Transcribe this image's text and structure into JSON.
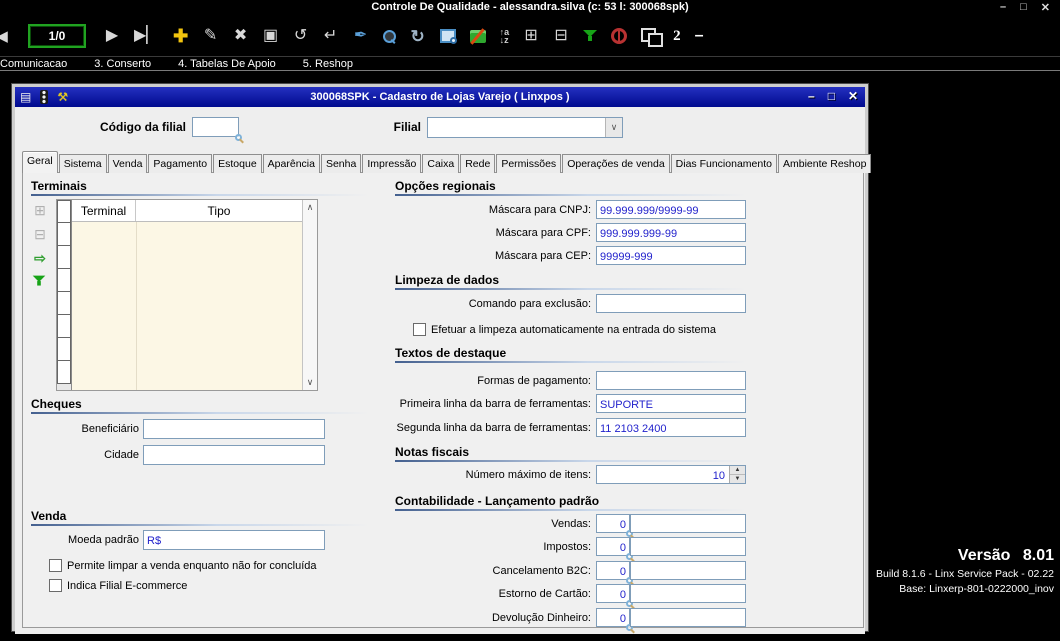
{
  "app": {
    "title": "Controle De Qualidade - alessandra.silva (c: 53 l: 300068spk)",
    "controls": {
      "minimize": "–",
      "maximize": "□",
      "close": "✕"
    }
  },
  "toolbar": {
    "record_counter": "1/0",
    "window_count": "2",
    "dash": "–",
    "icons": {
      "prev": "◀",
      "next": "▶",
      "last": "▶▏",
      "add": "✚",
      "edit": "✎",
      "delete": "✖",
      "save": "▣",
      "revert": "↺",
      "undo": "↵",
      "brush": "✒",
      "refresh": "↻",
      "sort_up": "↑a",
      "sort_down": "↓z",
      "add_detail": "⊞",
      "remove_detail": "⊟"
    }
  },
  "menubar": {
    "items": [
      {
        "label": "Comunicacao"
      },
      {
        "label": "3. Conserto"
      },
      {
        "label": "4. Tabelas De Apoio"
      },
      {
        "label": "5. Reshop"
      }
    ]
  },
  "dialog": {
    "title": "300068SPK - Cadastro de Lojas Varejo ( Linxpos )",
    "controls": {
      "minimize": "–",
      "maximize": "□",
      "close": "✕"
    },
    "header": {
      "codigo_label": "Código da filial",
      "codigo_value": "",
      "filial_label": "Filial",
      "filial_value": ""
    },
    "tabs": [
      {
        "label": "Geral"
      },
      {
        "label": "Sistema"
      },
      {
        "label": "Venda"
      },
      {
        "label": "Pagamento"
      },
      {
        "label": "Estoque"
      },
      {
        "label": "Aparência"
      },
      {
        "label": "Senha"
      },
      {
        "label": "Impressão"
      },
      {
        "label": "Caixa"
      },
      {
        "label": "Rede"
      },
      {
        "label": "Permissões"
      },
      {
        "label": "Operações de venda"
      },
      {
        "label": "Dias Funcionamento"
      },
      {
        "label": "Ambiente Reshop"
      }
    ],
    "terminais": {
      "title": "Terminais",
      "columns": {
        "terminal": "Terminal",
        "tipo": "Tipo"
      },
      "side_icons": {
        "insert": "⊞",
        "remove": "⊟",
        "export": "⇨"
      }
    },
    "cheques": {
      "title": "Cheques",
      "beneficiario_label": "Beneficiário",
      "beneficiario_value": "",
      "cidade_label": "Cidade",
      "cidade_value": ""
    },
    "venda": {
      "title": "Venda",
      "moeda_label": "Moeda padrão",
      "moeda_value": "R$",
      "checkbox_limpar": "Permite limpar a venda enquanto não for concluída",
      "checkbox_ecommerce": "Indica Filial E-commerce"
    },
    "opcoes_regionais": {
      "title": "Opções regionais",
      "rows": [
        {
          "label": "Máscara para CNPJ:",
          "value": "99.999.999/9999-99"
        },
        {
          "label": "Máscara para CPF:",
          "value": "999.999.999-99"
        },
        {
          "label": "Máscara para CEP:",
          "value": "99999-999"
        }
      ]
    },
    "limpeza": {
      "title": "Limpeza de dados",
      "comando_label": "Comando para exclusão:",
      "comando_value": "",
      "checkbox": "Efetuar a limpeza automaticamente na entrada do sistema"
    },
    "textos": {
      "title": "Textos de destaque",
      "rows": [
        {
          "label": "Formas de pagamento:",
          "value": ""
        },
        {
          "label": "Primeira linha da barra de ferramentas:",
          "value": "SUPORTE"
        },
        {
          "label": "Segunda linha da barra de ferramentas:",
          "value": "11 2103 2400"
        }
      ]
    },
    "notas": {
      "title": "Notas fiscais",
      "label": "Número máximo de itens:",
      "value": "10"
    },
    "contabilidade": {
      "title": "Contabilidade - Lançamento padrão",
      "rows": [
        {
          "label": "Vendas:",
          "value": "0"
        },
        {
          "label": "Impostos:",
          "value": "0"
        },
        {
          "label": "Cancelamento B2C:",
          "value": "0"
        },
        {
          "label": "Estorno de Cartão:",
          "value": "0"
        },
        {
          "label": "Devolução Dinheiro:",
          "value": "0"
        }
      ]
    }
  },
  "version": {
    "title": "Versão 8.01",
    "build": "Build 8.1.6 - Linx Service Pack - 02.22",
    "base": "Base: Linxerp-801-0222000_inov"
  }
}
